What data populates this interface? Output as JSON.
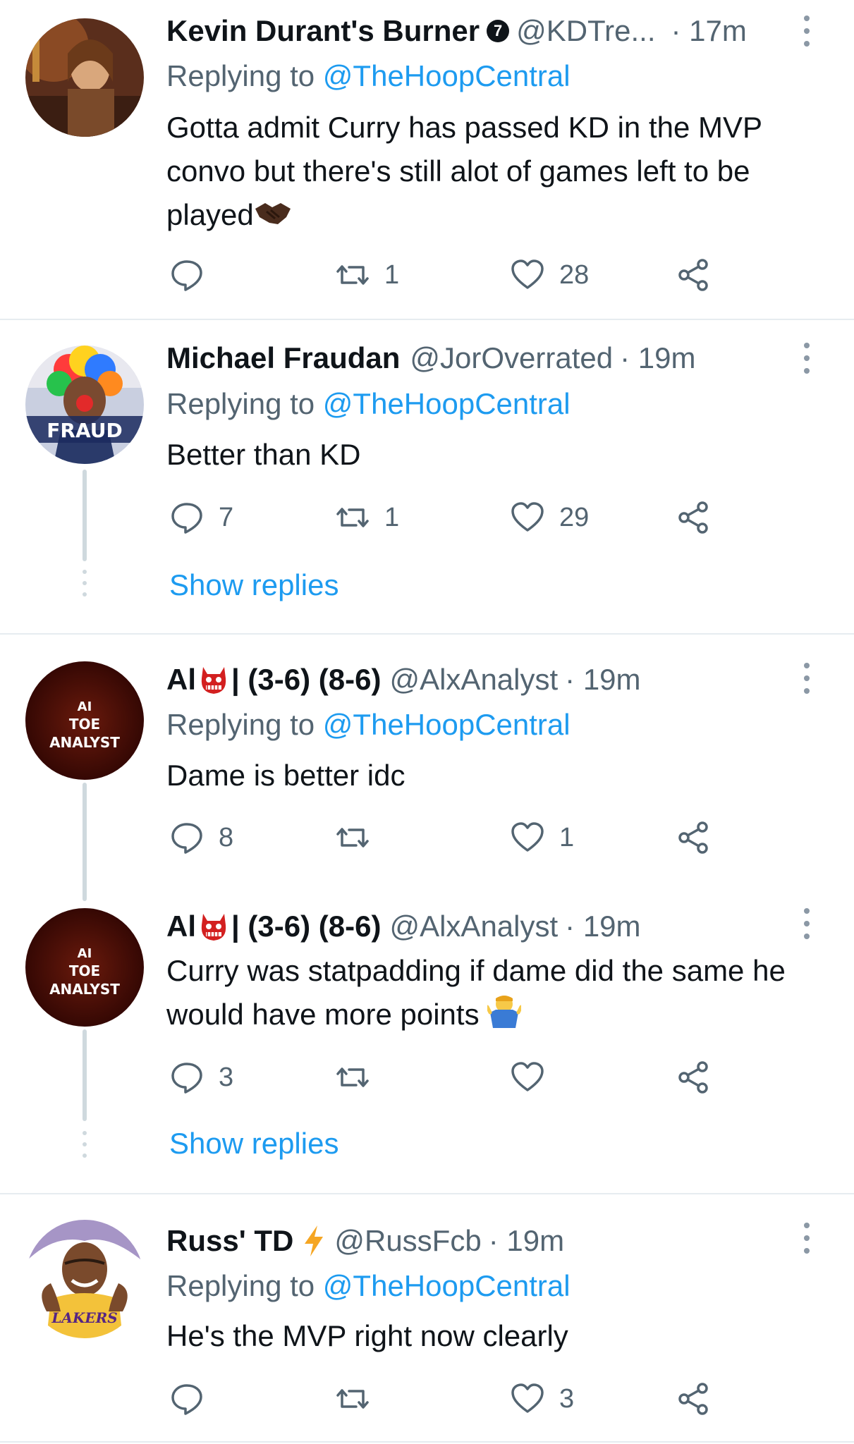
{
  "tweets": [
    {
      "name": "Kevin Durant's Burner",
      "verified_mark": "7",
      "handle": "@KDTre...",
      "time": "· 17m",
      "reply_prefix": "Replying to ",
      "reply_mention": "@TheHoopCentral",
      "text": "Gotta admit Curry has passed KD in the MVP convo but there's still alot of games left to be played",
      "text_emoji": "handshake-icon",
      "replies": "",
      "retweets": "1",
      "likes": "28"
    },
    {
      "name": "Michael Fraudan",
      "handle": "@JorOverrated",
      "time": "· 19m",
      "avatar_label": "FRAUD",
      "reply_prefix": "Replying to ",
      "reply_mention": "@TheHoopCentral",
      "text": "Better than KD",
      "replies": "7",
      "retweets": "1",
      "likes": "29",
      "show_replies": "Show replies"
    },
    {
      "name": "Al",
      "name_suffix": "| (3-6) (8-6)",
      "name_emoji": "ogre-icon",
      "handle": "@AlxAnalyst",
      "time": "· 19m",
      "avatar_label": [
        "AI",
        "TOE",
        "ANALYST"
      ],
      "reply_prefix": "Replying to ",
      "reply_mention": "@TheHoopCentral",
      "text": "Dame is better idc",
      "replies": "8",
      "retweets": "",
      "likes": "1"
    },
    {
      "name": "Al",
      "name_suffix": "| (3-6) (8-6)",
      "name_emoji": "ogre-icon",
      "handle": "@AlxAnalyst",
      "time": "· 19m",
      "avatar_label": [
        "AI",
        "TOE",
        "ANALYST"
      ],
      "text": "Curry was statpadding if dame did the same he would have more points",
      "text_emoji": "shrug-icon",
      "replies": "3",
      "retweets": "",
      "likes": "",
      "show_replies": "Show replies"
    },
    {
      "name": "Russ' TD",
      "name_emoji": "lightning-icon",
      "handle": "@RussFcb",
      "time": "· 19m",
      "avatar_label": "LAKERS",
      "reply_prefix": "Replying to ",
      "reply_mention": "@TheHoopCentral",
      "text": "He's the MVP right now clearly",
      "replies": "",
      "retweets": "",
      "likes": "3"
    }
  ],
  "colors": {
    "accent": "#1d9bf0",
    "secondary_text": "#536471",
    "divider": "#e6ecf0",
    "thread_line": "#cfd9de",
    "lightning": "#f5a623"
  }
}
